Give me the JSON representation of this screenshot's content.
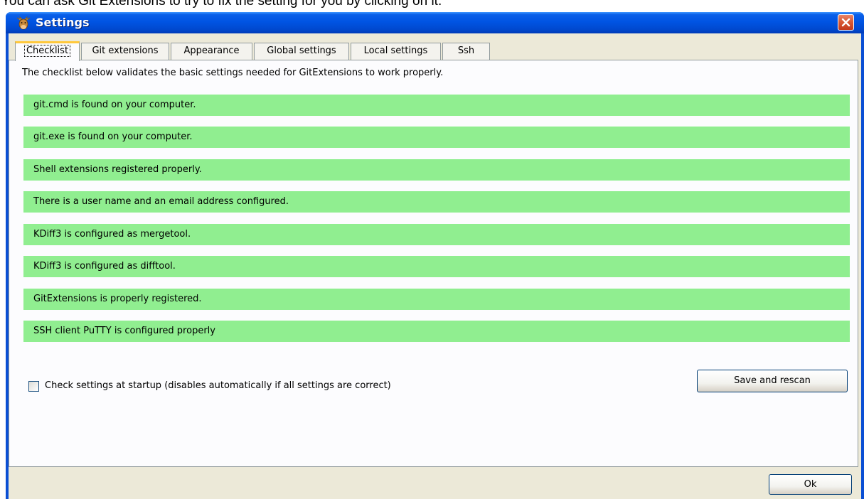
{
  "caption": "You can ask Git Extensions to try to fix the setting for you by clicking on it.",
  "window": {
    "title": "Settings",
    "icon": "git-extensions-cow-icon",
    "close_icon": "close-icon"
  },
  "tabs": [
    {
      "label": "Checklist",
      "active": true
    },
    {
      "label": "Git extensions",
      "active": false
    },
    {
      "label": "Appearance",
      "active": false
    },
    {
      "label": "Global settings",
      "active": false
    },
    {
      "label": "Local settings",
      "active": false
    },
    {
      "label": "Ssh",
      "active": false
    }
  ],
  "checklist": {
    "description": "The checklist below validates the basic settings needed for GitExtensions to work properly.",
    "ok_color": "#90ee90",
    "items": [
      {
        "text": "git.cmd is found on your computer."
      },
      {
        "text": "git.exe is found on your computer."
      },
      {
        "text": "Shell extensions registered properly."
      },
      {
        "text": "There is a user name and an email address configured."
      },
      {
        "text": "KDiff3 is configured as mergetool."
      },
      {
        "text": "KDiff3 is configured as difftool."
      },
      {
        "text": "GitExtensions is properly registered."
      },
      {
        "text": "SSH client PuTTY is configured properly"
      }
    ],
    "startup_check": {
      "label": "Check settings at startup (disables automatically if all settings are correct)",
      "checked": false
    },
    "rescan_button": "Save and rescan"
  },
  "footer": {
    "ok_button": "Ok"
  },
  "colors": {
    "titlebar": "#0054e3",
    "dialog_background": "#ece9d8",
    "active_tab_highlight": "#ffc83c",
    "close_button": "#d85a35"
  }
}
